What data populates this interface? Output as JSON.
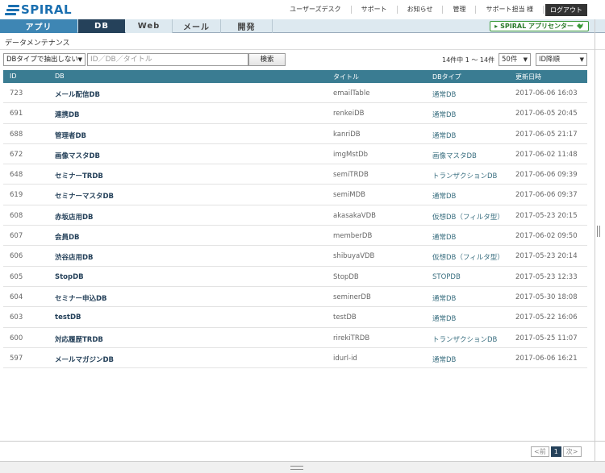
{
  "brand": {
    "name": "SPIRAL",
    "color": "#1a6fb0"
  },
  "topnav": {
    "items": [
      "ユーザーズデスク",
      "サポート",
      "お知らせ",
      "管理",
      "サポート担当 様"
    ],
    "logout": "ログアウト"
  },
  "tabs": [
    "アプリ",
    "DB",
    "Web",
    "メール",
    "開発"
  ],
  "active_tab": "DB",
  "app_center": "SPIRAL アプリセンター",
  "breadcrumb": "データメンテナンス",
  "filter": {
    "dbtype_selected": "DBタイプで抽出しない",
    "search_placeholder": "ID／DB／タイトル",
    "search_button": "検索",
    "count_text": "14件中 1 ～ 14件",
    "perpage_selected": "50件",
    "sort_selected": "ID降順"
  },
  "table": {
    "headers": {
      "id": "ID",
      "db": "DB",
      "title": "タイトル",
      "type": "DBタイプ",
      "updated": "更新日時"
    },
    "rows": [
      {
        "id": "723",
        "db": "メール配信DB",
        "title": "emailTable",
        "type": "通常DB",
        "updated": "2017-06-06 16:03"
      },
      {
        "id": "691",
        "db": "連携DB",
        "title": "renkeiDB",
        "type": "通常DB",
        "updated": "2017-06-05 20:45"
      },
      {
        "id": "688",
        "db": "管理者DB",
        "title": "kanriDB",
        "type": "通常DB",
        "updated": "2017-06-05 21:17"
      },
      {
        "id": "672",
        "db": "画像マスタDB",
        "title": "imgMstDb",
        "type": "画像マスタDB",
        "updated": "2017-06-02 11:48"
      },
      {
        "id": "648",
        "db": "セミナーTRDB",
        "title": "semiTRDB",
        "type": "トランザクションDB",
        "updated": "2017-06-06 09:39"
      },
      {
        "id": "619",
        "db": "セミナーマスタDB",
        "title": "semiMDB",
        "type": "通常DB",
        "updated": "2017-06-06 09:37"
      },
      {
        "id": "608",
        "db": "赤坂店用DB",
        "title": "akasakaVDB",
        "type": "仮想DB（フィルタ型）",
        "updated": "2017-05-23 20:15"
      },
      {
        "id": "607",
        "db": "会員DB",
        "title": "memberDB",
        "type": "通常DB",
        "updated": "2017-06-02 09:50"
      },
      {
        "id": "606",
        "db": "渋谷店用DB",
        "title": "shibuyaVDB",
        "type": "仮想DB（フィルタ型）",
        "updated": "2017-05-23 20:14"
      },
      {
        "id": "605",
        "db": "StopDB",
        "title": "StopDB",
        "type": "STOPDB",
        "updated": "2017-05-23 12:33"
      },
      {
        "id": "604",
        "db": "セミナー申込DB",
        "title": "seminerDB",
        "type": "通常DB",
        "updated": "2017-05-30 18:08"
      },
      {
        "id": "603",
        "db": "testDB",
        "title": "testDB",
        "type": "通常DB",
        "updated": "2017-05-22 16:06"
      },
      {
        "id": "600",
        "db": "対応履歴TRDB",
        "title": "rirekiTRDB",
        "type": "トランザクションDB",
        "updated": "2017-05-25 11:07"
      },
      {
        "id": "597",
        "db": "メールマガジンDB",
        "title": "idurl-id",
        "type": "通常DB",
        "updated": "2017-06-06 16:21"
      }
    ]
  },
  "pager": {
    "prev": "<前",
    "current": "1",
    "next": "次>"
  },
  "colors": {
    "header_bg": "#3a7c92",
    "active_tab": "#25415a",
    "appli_tab": "#3e86b4"
  }
}
